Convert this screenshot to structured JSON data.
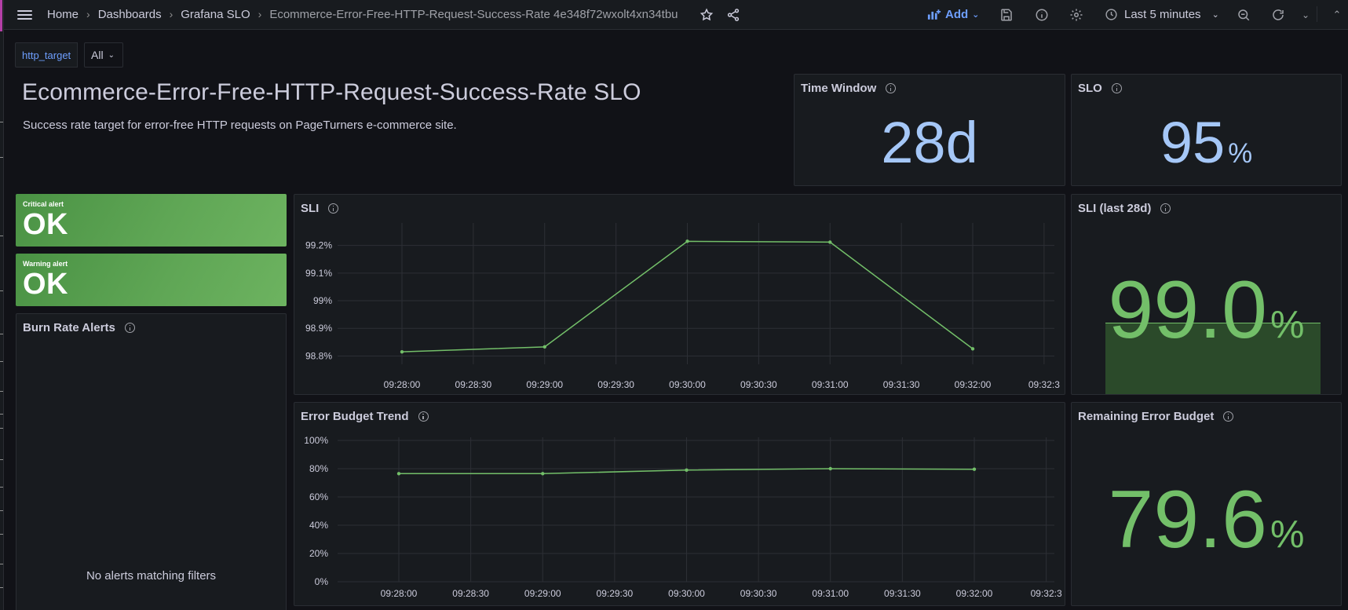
{
  "nav": {
    "breadcrumbs": [
      "Home",
      "Dashboards",
      "Grafana SLO",
      "Ecommerce-Error-Free-HTTP-Request-Success-Rate 4e348f72wxolt4xn34tbu"
    ],
    "add_label": "Add",
    "time_range": "Last 5 minutes"
  },
  "variables": {
    "label": "http_target",
    "value": "All"
  },
  "text_panel": {
    "title": "Ecommerce-Error-Free-HTTP-Request-Success-Rate SLO",
    "description": "Success rate target for error-free HTTP requests on PageTurners e-commerce site."
  },
  "time_window": {
    "title": "Time Window",
    "value": "28d"
  },
  "slo": {
    "title": "SLO",
    "value": "95",
    "unit": "%"
  },
  "alerts": {
    "critical": {
      "label": "Critical alert",
      "value": "OK"
    },
    "warning": {
      "label": "Warning alert",
      "value": "OK"
    }
  },
  "burn_rate": {
    "title": "Burn Rate Alerts",
    "empty_text": "No alerts matching filters"
  },
  "sli_panel": {
    "title": "SLI"
  },
  "sli_28d": {
    "title": "SLI (last 28d)",
    "value": "99.0",
    "unit": "%",
    "fill_fraction": 0.6
  },
  "ebt_panel": {
    "title": "Error Budget Trend"
  },
  "remaining": {
    "title": "Remaining Error Budget",
    "value": "79.6",
    "unit": "%"
  },
  "colors": {
    "series": "#73bf69",
    "stat_blue": "#a5c7f7",
    "accent": "#6e9fff"
  },
  "chart_data": [
    {
      "type": "line",
      "title": "SLI",
      "x": [
        "09:28:00",
        "09:29:00",
        "09:30:00",
        "09:31:00",
        "09:32:00"
      ],
      "x_tick_labels": [
        "09:28:00",
        "09:28:30",
        "09:29:00",
        "09:29:30",
        "09:30:00",
        "09:30:30",
        "09:31:00",
        "09:31:30",
        "09:32:00",
        "09:32:3"
      ],
      "y_tick_labels": [
        "99.2%",
        "99.1%",
        "99%",
        "98.9%",
        "98.8%"
      ],
      "y_tick_values": [
        99.2,
        99.1,
        99.0,
        98.9,
        98.8
      ],
      "ylim": [
        98.77,
        99.27
      ],
      "series": [
        {
          "values": [
            98.815,
            98.833,
            99.215,
            99.212,
            98.826
          ]
        }
      ],
      "grid": true
    },
    {
      "type": "line",
      "title": "Error Budget Trend",
      "x": [
        "09:28:00",
        "09:29:00",
        "09:30:00",
        "09:31:00",
        "09:32:00"
      ],
      "x_tick_labels": [
        "09:28:00",
        "09:28:30",
        "09:29:00",
        "09:29:30",
        "09:30:00",
        "09:30:30",
        "09:31:00",
        "09:31:30",
        "09:32:00",
        "09:32:3"
      ],
      "y_tick_labels": [
        "100%",
        "80%",
        "60%",
        "40%",
        "20%",
        "0%"
      ],
      "y_tick_values": [
        100,
        80,
        60,
        40,
        20,
        0
      ],
      "ylim": [
        0,
        100
      ],
      "series": [
        {
          "values": [
            76.5,
            76.5,
            79.0,
            80.0,
            79.6
          ]
        }
      ],
      "grid": true
    }
  ]
}
